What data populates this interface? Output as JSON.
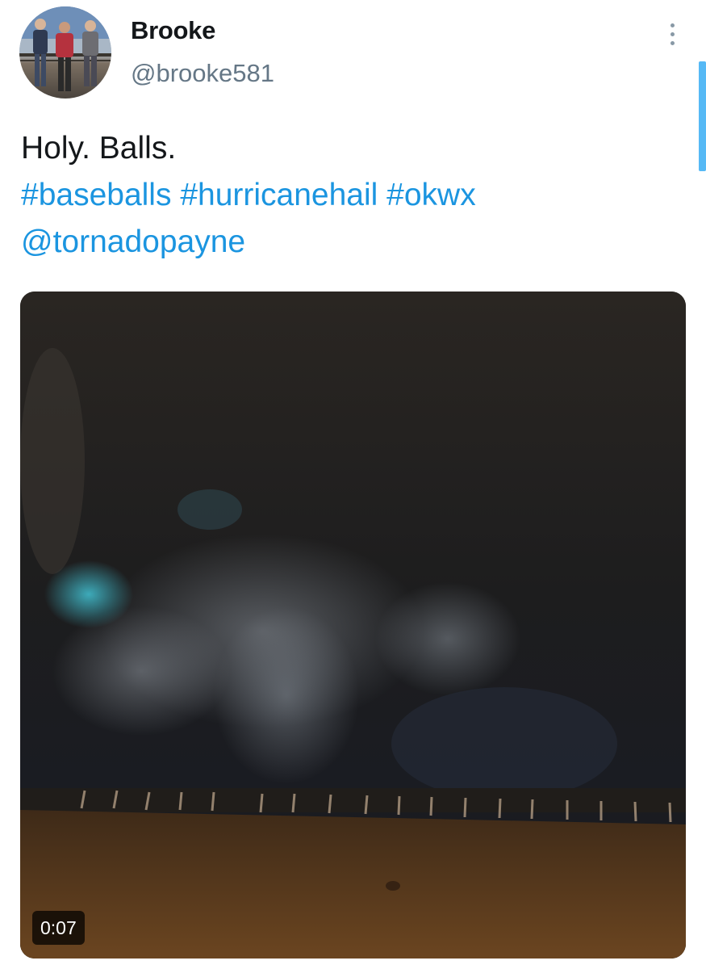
{
  "tweet": {
    "author": {
      "display_name": "Brooke",
      "handle": "@brooke581"
    },
    "text": {
      "body": "Holy. Balls.",
      "hashtags": [
        "#baseballs",
        "#hurricanehail",
        "#okwx"
      ],
      "mention": "@tornadopayne"
    },
    "media": {
      "type": "video",
      "duration": "0:07"
    },
    "menu_icon": "more-vertical-icon"
  },
  "colors": {
    "link": "#1b95e0",
    "text": "#14171a",
    "secondary": "#657786",
    "scroll_indicator": "#1da1f2"
  }
}
